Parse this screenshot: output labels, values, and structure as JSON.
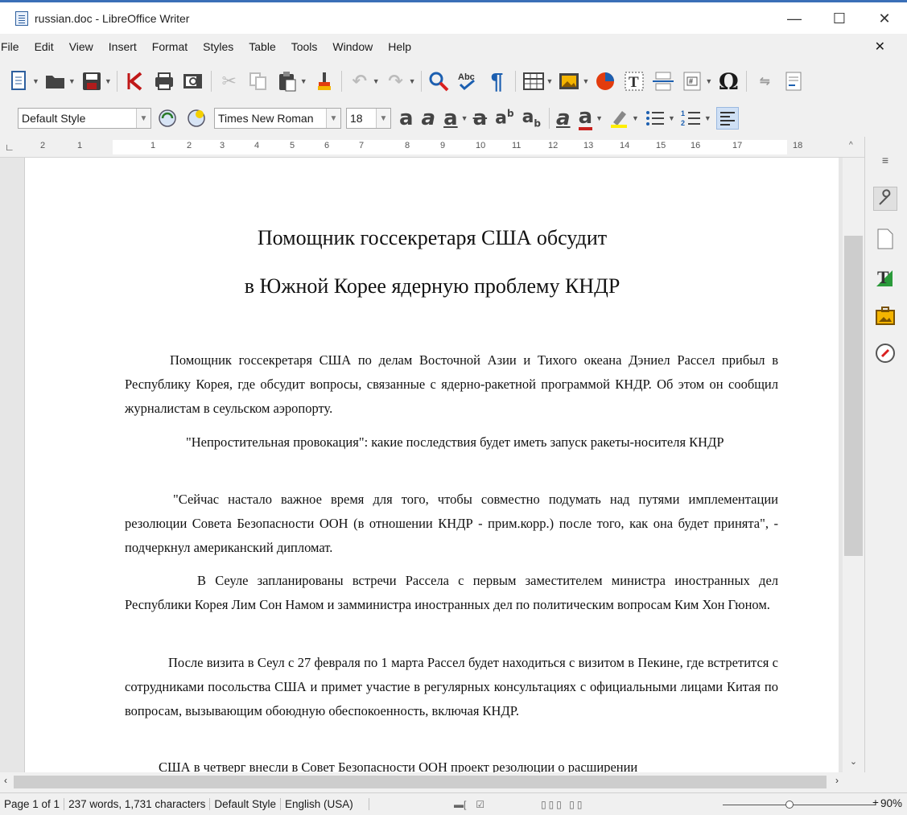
{
  "window": {
    "title": "russian.doc - LibreOffice Writer",
    "minimize": "—",
    "maximize": "☐",
    "close": "✕"
  },
  "menu": {
    "items": [
      "File",
      "Edit",
      "View",
      "Insert",
      "Format",
      "Styles",
      "Table",
      "Tools",
      "Window",
      "Help"
    ],
    "close_document": "✕"
  },
  "formatting": {
    "paragraph_style": "Default Style",
    "font_name": "Times New Roman",
    "font_size": "18"
  },
  "ruler": {
    "numbers": [
      "2",
      "1",
      "1",
      "1",
      "2",
      "3",
      "4",
      "5",
      "6",
      "7",
      "8",
      "9",
      "10",
      "11",
      "12",
      "13",
      "14",
      "15",
      "16",
      "17",
      "18"
    ]
  },
  "document": {
    "title_line1": "Помощник госсекретаря США обсудит",
    "title_line2": "в Южной Корее ядерную проблему КНДР",
    "paragraphs": [
      "Помощник госсекретаря США по делам Восточной Азии и Тихого океана Дэниел Рассел прибыл в Республику Корея, где обсудит вопросы, связанные с ядерно-ракетной программой КНДР. Об этом он сообщил журналистам в сеульском аэропорту.",
      "\"Непростительная провокация\": какие последствия будет иметь запуск ракеты-носителя КНДР",
      "\"Сейчас настало важное время для того, чтобы совместно подумать над путями имплементации резолюции Совета Безопасности ООН (в отношении КНДР - прим.корр.) после того, как она будет принята\", - подчеркнул американский дипломат.",
      "В Сеуле запланированы встречи Рассела с первым заместителем министра иностранных дел Республики Корея Лим Сон Намом и замминистра иностранных дел по политическим вопросам Ким Хон Гюном.",
      "После визита в Сеул с 27 февраля по 1 марта Рассел будет находиться с визитом в Пекине, где встретится с сотрудниками посольства США и примет участие в регулярных консультациях с официальными лицами Китая по вопросам, вызывающим обоюдную обеспокоенность, включая КНДР.",
      "США в четверг внесли в Совет Безопасности ООН проект резолюции о расширении"
    ]
  },
  "status": {
    "page": "Page 1 of 1",
    "words": "237 words, 1,731 characters",
    "style": "Default Style",
    "language": "English (USA)",
    "zoom": "90%"
  },
  "icons": {
    "sidebar": [
      "properties-icon",
      "page-icon",
      "styles-icon",
      "gallery-icon",
      "navigator-icon"
    ]
  }
}
